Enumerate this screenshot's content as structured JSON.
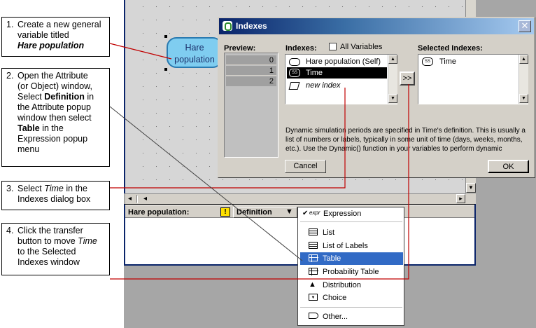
{
  "callouts": [
    {
      "num": "1.",
      "lines": [
        "Create a new general",
        "variable titled"
      ],
      "em": "Hare population"
    },
    {
      "num": "2.",
      "parts": [
        "Open the Attribute",
        "(or Object) window,",
        "Select "
      ],
      "bold1": "Definition",
      "parts2": [
        " in",
        "the Attribute popup",
        "window then select"
      ],
      "bold2": "Table",
      "parts3": [
        " in the",
        "Expression popup",
        "menu"
      ]
    },
    {
      "num": "3.",
      "pre": "Select ",
      "em": "Time",
      "post": " in the",
      "line2": "Indexes dialog box"
    },
    {
      "num": "4.",
      "l1": "Click the transfer",
      "l2pre": "button to move ",
      "l2em": "Time",
      "l3": "to the Selected",
      "l4": "Indexes window"
    }
  ],
  "diagram": {
    "node_label_1": "Hare",
    "node_label_2": "population"
  },
  "dialog": {
    "title": "Indexes",
    "preview_label": "Preview:",
    "preview_rows": [
      "0",
      "1",
      "2"
    ],
    "indexes_label": "Indexes:",
    "all_variables_label": "All Variables",
    "indexes_items": [
      "Hare population (Self)",
      "Time",
      "new index"
    ],
    "transfer_label": ">>",
    "selected_label": "Selected Indexes:",
    "selected_items": [
      "Time"
    ],
    "description_lines": [
      "Dynamic simulation periods are specified in Time's definition. This is usually a",
      "list of numbers or labels, typically in some unit of time (days, weeks, months,",
      "etc.).  Use the Dynamic() function in your variables to perform dynamic"
    ],
    "cancel_label": "Cancel",
    "ok_label": "OK"
  },
  "attribute": {
    "variable_label": "Hare population:",
    "attribute_value": "Definition"
  },
  "menu": {
    "items": [
      "Expression",
      "List",
      "List of Labels",
      "Table",
      "Probability Table",
      "Distribution",
      "Choice",
      "Other..."
    ],
    "checked": "Expression",
    "highlighted": "Table",
    "expr_icon_text": "expr"
  },
  "colors": {
    "title_bar": "#0a246a",
    "selection": "#0a246a",
    "menu_highlight": "#316ac5",
    "node_fill": "#7fcdf0",
    "annotation_line": "#c00000"
  }
}
